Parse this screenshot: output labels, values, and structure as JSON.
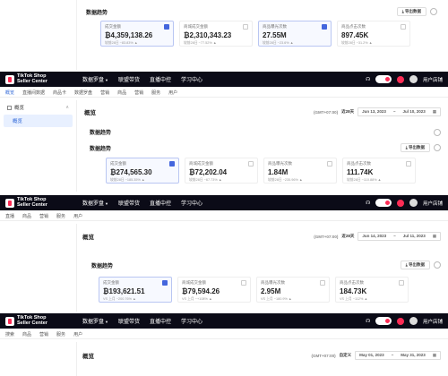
{
  "top_fragment": {
    "section_title": "数据趋势",
    "export_label": "导出数据",
    "cards": [
      {
        "label": "成交金额",
        "value": "₿4,359,138.26",
        "compare": "较前28日 ~83.83% ▲",
        "selected": true
      },
      {
        "label": "商城成交金额",
        "value": "₿2,310,343.23",
        "compare": "较前28日 ~77.52% ▲",
        "selected": false
      },
      {
        "label": "商品曝光次数",
        "value": "27.55M",
        "compare": "较前28日 ~23.6% ▲",
        "selected": true
      },
      {
        "label": "商品点击次数",
        "value": "897.45K",
        "compare": "较前28日 ~31.2% ▲",
        "selected": false
      }
    ]
  },
  "brand": {
    "line1": "TikTok Shop",
    "line2": "Seller Center"
  },
  "nav_items": [
    "数据罗盘",
    "联盟带货",
    "直播中控",
    "学习中心"
  ],
  "nav_right": {
    "user": "用户店铺"
  },
  "subnav_1": [
    "概览",
    "直播间数据",
    "商品卡",
    "数据罗盘",
    "营销",
    "商品",
    "营销",
    "服务",
    "用户"
  ],
  "sidebar": {
    "group": "概览",
    "selected": "概览"
  },
  "panel_1": {
    "title": "概览",
    "timezone": "(GMT+07:00)",
    "period_label": "近28天",
    "start": "Jun 13, 2023",
    "end": "Jul 10, 2023",
    "section_title_a": "数据趋势",
    "section_title_b": "数据趋势",
    "export_label": "导出数据",
    "cards": [
      {
        "label": "成交金额",
        "value": "₿274,565.30",
        "compare": "较前28日 ~185.35% ▲",
        "selected": true
      },
      {
        "label": "商城成交金额",
        "value": "₿72,202.04",
        "compare": "较前28日 ~67.73% ▲",
        "selected": false
      },
      {
        "label": "商品曝光次数",
        "value": "1.84M",
        "compare": "较前28日 ~235.96% ▲",
        "selected": false
      },
      {
        "label": "商品点击次数",
        "value": "111.74K",
        "compare": "较前28日 ~110.88% ▲",
        "selected": false
      }
    ]
  },
  "subnav_2": [
    "直播",
    "商品",
    "营销",
    "服务",
    "用户"
  ],
  "panel_2": {
    "title": "概览",
    "timezone": "(GMT+07:00)",
    "period_label": "近28天",
    "start": "Jun 14, 2023",
    "end": "Jul 11, 2023",
    "section_title": "数据趋势",
    "export_label": "导出数据",
    "cards": [
      {
        "label": "成交金额",
        "value": "₿193,621.51",
        "compare": "VS 上月 ~200.76% ▲",
        "selected": true
      },
      {
        "label": "商城成交金额",
        "value": "₿79,594.26",
        "compare": "VS 上月 ~+108% ▲",
        "selected": false
      },
      {
        "label": "商品曝光次数",
        "value": "2.95M",
        "compare": "VS 上月 ~180.9% ▲",
        "selected": false
      },
      {
        "label": "商品点击次数",
        "value": "184.73K",
        "compare": "VS 上月 ~112% ▲",
        "selected": false
      }
    ]
  },
  "subnav_3": [
    "搜索",
    "商品",
    "营销",
    "服务",
    "用户"
  ],
  "panel_3": {
    "title": "概览",
    "timezone": "(GMT+07:00)",
    "period_label": "自定义",
    "start": "May 01, 2023",
    "end": "May 31, 2023"
  }
}
